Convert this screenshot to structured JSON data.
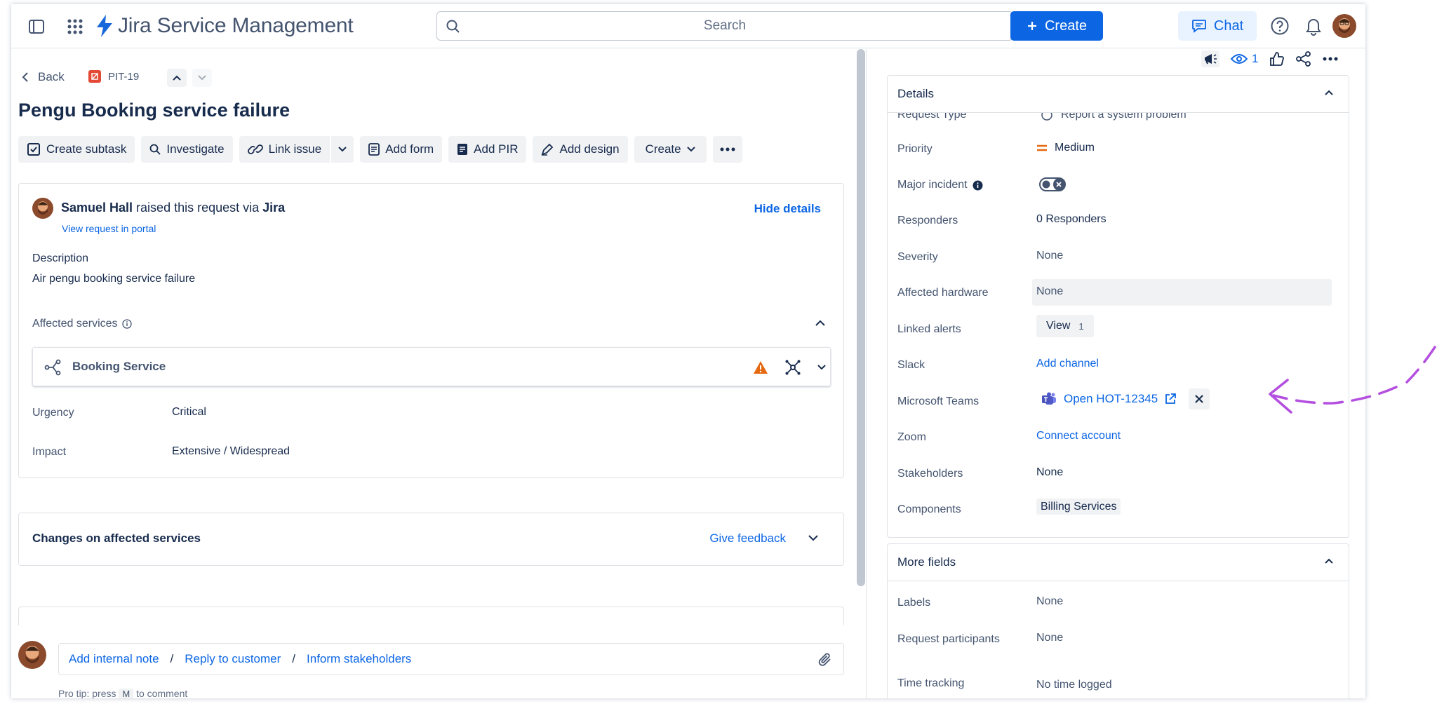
{
  "app": {
    "name": "Jira Service Management"
  },
  "search": {
    "placeholder": "Search"
  },
  "topbar": {
    "create_label": "Create",
    "chat_label": "Chat"
  },
  "issue": {
    "back_label": "Back",
    "key": "PIT-19",
    "title": "Pengu Booking service failure"
  },
  "toolbar": {
    "create_subtask": "Create subtask",
    "investigate": "Investigate",
    "link_issue": "Link issue",
    "add_form": "Add form",
    "add_pir": "Add PIR",
    "add_design": "Add design",
    "create": "Create"
  },
  "request": {
    "reporter": "Samuel Hall",
    "raised_text": " raised this request via ",
    "channel": "Jira",
    "view_portal": "View request in portal",
    "hide_details": "Hide details",
    "description_label": "Description",
    "description": "Air pengu booking service failure",
    "affected_services_label": "Affected services",
    "service_name": "Booking Service",
    "urgency_label": "Urgency",
    "urgency": "Critical",
    "impact_label": "Impact",
    "impact": "Extensive / Widespread"
  },
  "changes": {
    "title": "Changes on affected services",
    "feedback": "Give feedback"
  },
  "comment": {
    "internal_note": "Add internal note",
    "reply_customer": "Reply to customer",
    "inform_stakeholders": "Inform stakeholders",
    "slash": "/",
    "protip_pre": "Pro tip: press",
    "protip_key": "M",
    "protip_post": "to comment"
  },
  "right": {
    "watch_count": "1"
  },
  "details": {
    "title": "Details",
    "request_type_label": "Request Type",
    "request_type": "Report a system problem",
    "priority_label": "Priority",
    "priority": "Medium",
    "major_incident_label": "Major incident",
    "responders_label": "Responders",
    "responders": "0 Responders",
    "severity_label": "Severity",
    "severity": "None",
    "hardware_label": "Affected hardware",
    "hardware": "None",
    "alerts_label": "Linked alerts",
    "alerts_view": "View",
    "alerts_count": "1",
    "slack_label": "Slack",
    "slack": "Add channel",
    "teams_label": "Microsoft Teams",
    "teams": "Open HOT-12345",
    "zoom_label": "Zoom",
    "zoom": "Connect account",
    "stakeholders_label": "Stakeholders",
    "stakeholders": "None",
    "components_label": "Components",
    "components": "Billing Services"
  },
  "more_fields": {
    "title": "More fields",
    "labels_label": "Labels",
    "labels": "None",
    "participants_label": "Request participants",
    "participants": "None",
    "time_label": "Time tracking",
    "time": "No time logged"
  },
  "colors": {
    "brand": "#0c66e4",
    "annotation": "#b44fe0",
    "warning": "#e56910"
  }
}
